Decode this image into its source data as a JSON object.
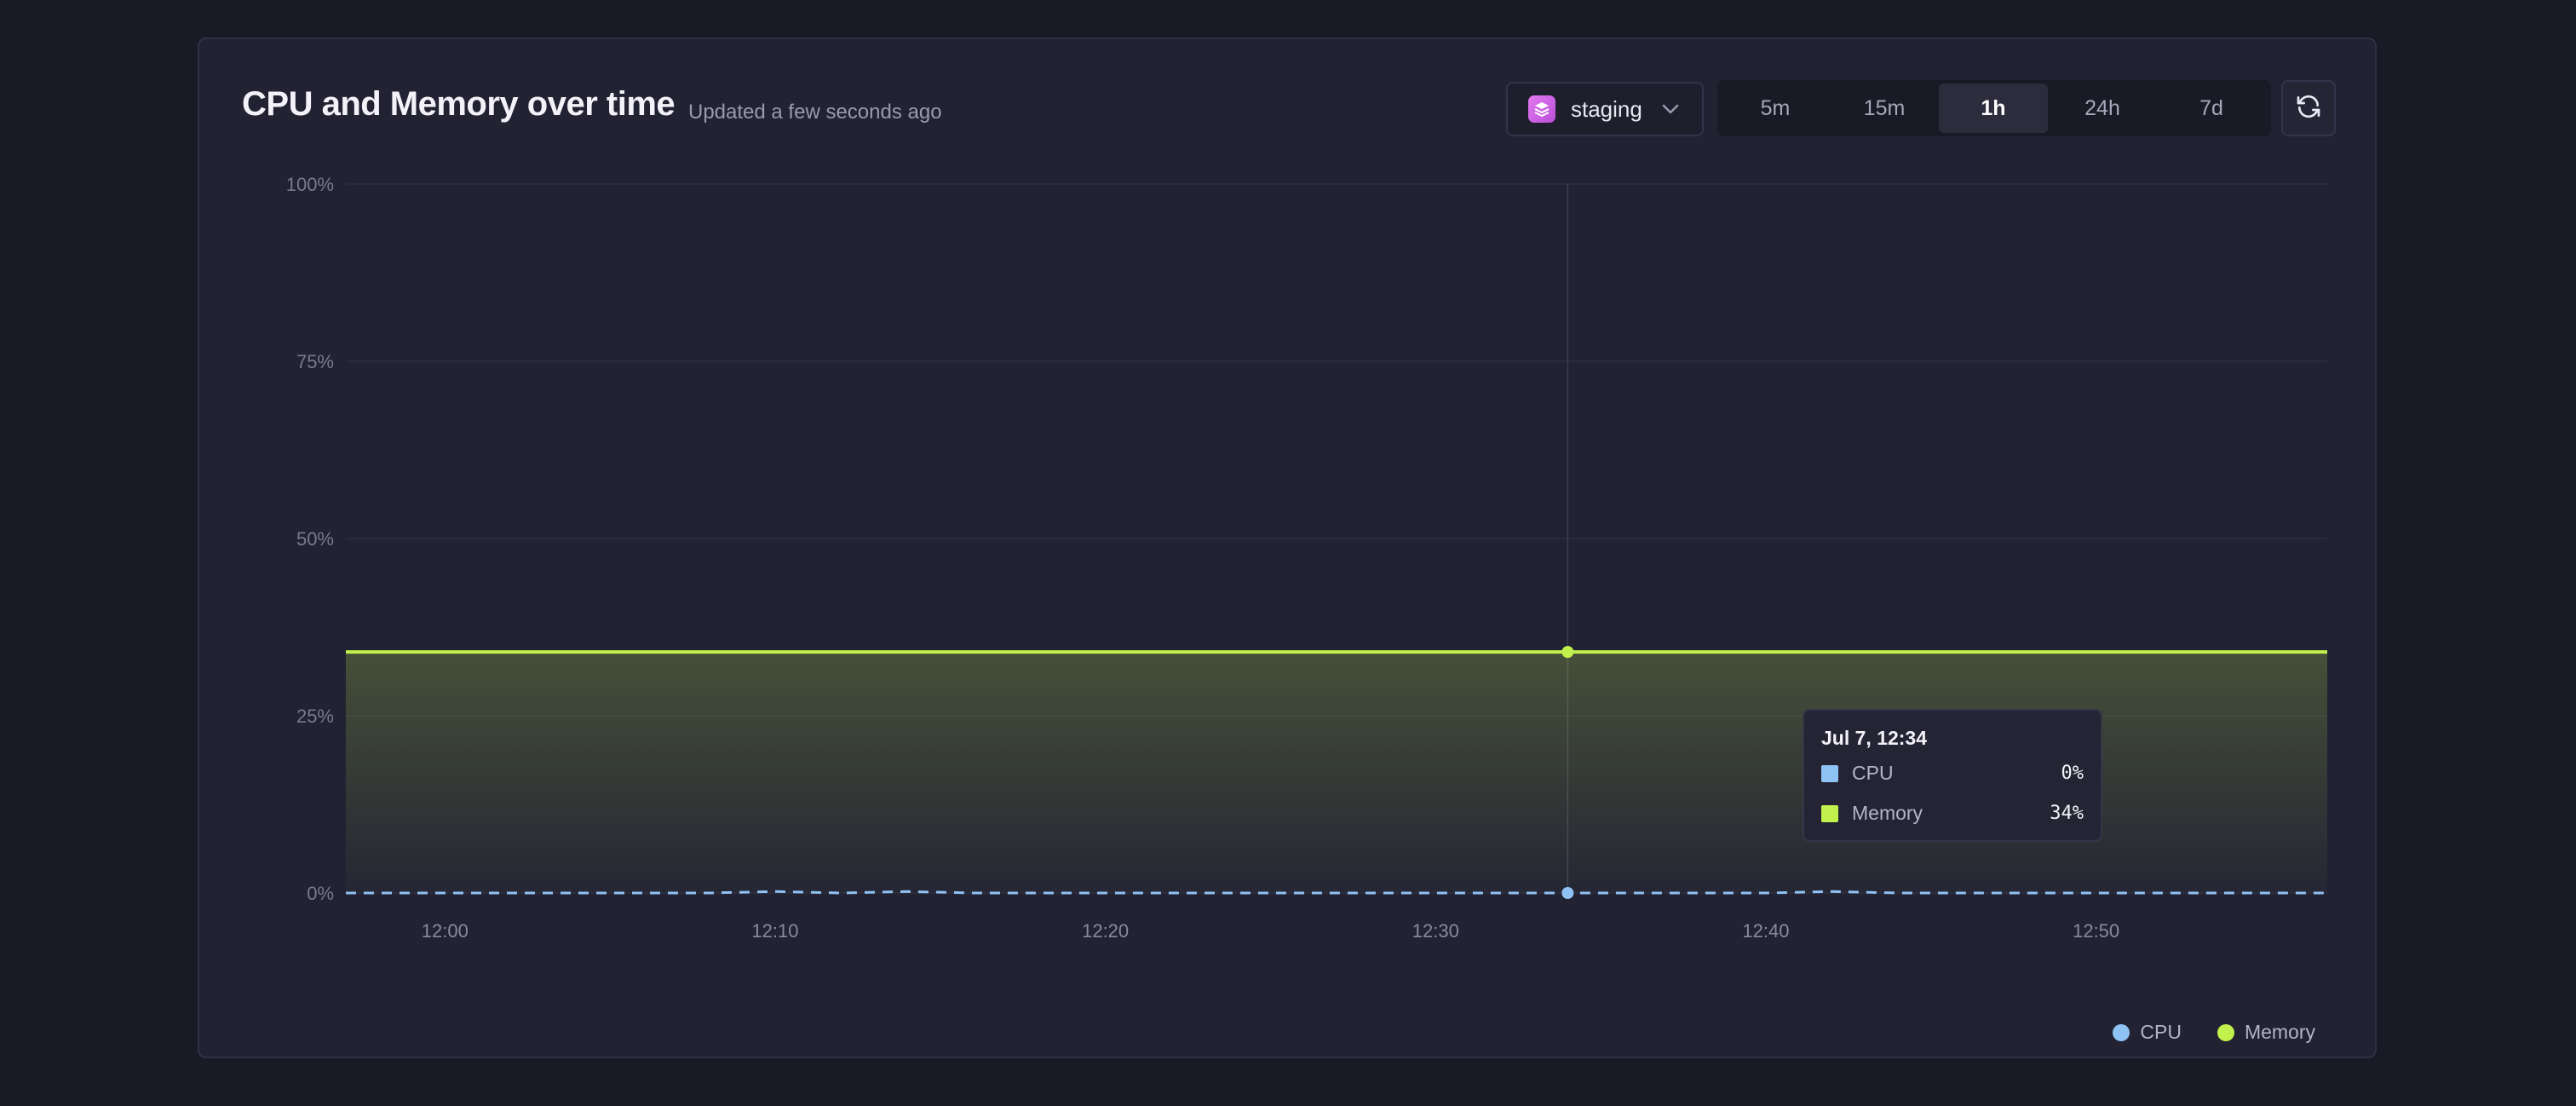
{
  "header": {
    "title": "CPU and Memory over time",
    "subtitle": "Updated a few seconds ago"
  },
  "environment": {
    "selected": "staging"
  },
  "time_ranges": {
    "options": [
      "5m",
      "15m",
      "1h",
      "24h",
      "7d"
    ],
    "active": "1h"
  },
  "colors": {
    "cpu": "#8fc2f5",
    "memory": "#c2f04c",
    "background": "#222233",
    "grid": "#2e2e40"
  },
  "icons": {
    "environment": "layers-icon",
    "dropdown": "chevron-down-icon",
    "refresh": "refresh-icon"
  },
  "tooltip": {
    "title": "Jul 7, 12:34",
    "rows": [
      {
        "label": "CPU",
        "value": "0%"
      },
      {
        "label": "Memory",
        "value": "34%"
      }
    ]
  },
  "chart_data": {
    "type": "area",
    "x_domain": [
      "11:57",
      "12:57"
    ],
    "x_ticks": [
      "12:00",
      "12:10",
      "12:20",
      "12:30",
      "12:40",
      "12:50"
    ],
    "y_ticks": [
      "0%",
      "25%",
      "50%",
      "75%",
      "100%"
    ],
    "ylim": [
      0,
      100
    ],
    "grid": true,
    "legend_position": "bottom-right",
    "hover_time": "12:34",
    "series": [
      {
        "name": "CPU",
        "style": "dashed-line",
        "x": [
          "11:57",
          "12:08",
          "12:10",
          "12:12",
          "12:14",
          "12:16",
          "12:40",
          "12:42",
          "12:44",
          "12:57"
        ],
        "y": [
          0,
          0,
          0.2,
          0,
          0.2,
          0,
          0,
          0.2,
          0,
          0
        ]
      },
      {
        "name": "Memory",
        "style": "area",
        "x": [
          "11:57",
          "12:57"
        ],
        "y": [
          34,
          34
        ]
      }
    ],
    "legend": [
      "CPU",
      "Memory"
    ]
  }
}
